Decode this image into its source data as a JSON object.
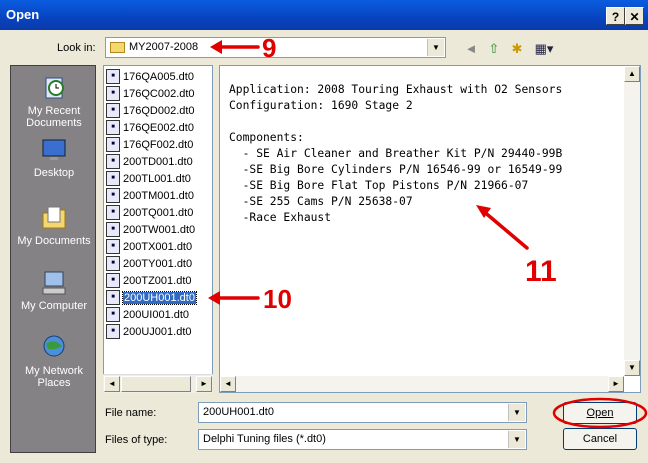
{
  "window": {
    "title": "Open",
    "help_label": "?",
    "close_label": "✕"
  },
  "look_in": {
    "label": "Look in:",
    "value": "MY2007-2008"
  },
  "places": [
    {
      "label": "My Recent Documents",
      "icon": "recent-documents-icon"
    },
    {
      "label": "Desktop",
      "icon": "desktop-icon"
    },
    {
      "label": "My Documents",
      "icon": "my-documents-icon"
    },
    {
      "label": "My Computer",
      "icon": "my-computer-icon"
    },
    {
      "label": "My Network Places",
      "icon": "network-places-icon"
    }
  ],
  "files": [
    "176QA005.dt0",
    "176QC002.dt0",
    "176QD002.dt0",
    "176QE002.dt0",
    "176QF002.dt0",
    "200TD001.dt0",
    "200TL001.dt0",
    "200TM001.dt0",
    "200TQ001.dt0",
    "200TW001.dt0",
    "200TX001.dt0",
    "200TY001.dt0",
    "200TZ001.dt0",
    "200UH001.dt0",
    "200UI001.dt0",
    "200UJ001.dt0"
  ],
  "selected_file": "200UH001.dt0",
  "preview": {
    "line1": "Application: 2008 Touring Exhaust with O2 Sensors",
    "line2": "Configuration: 1690 Stage 2",
    "line3": "",
    "line4": "Components:",
    "line5": "  - SE Air Cleaner and Breather Kit P/N 29440-99B",
    "line6": "  -SE Big Bore Cylinders P/N 16546-99 or 16549-99",
    "line7": "  -SE Big Bore Flat Top Pistons P/N 21966-07",
    "line8": "  -SE 255 Cams P/N 25638-07",
    "line9": "  -Race Exhaust"
  },
  "file_name": {
    "label": "File name:",
    "value": "200UH001.dt0"
  },
  "file_type": {
    "label": "Files of type:",
    "value": "Delphi Tuning files (*.dt0)"
  },
  "buttons": {
    "open": "Open",
    "cancel": "Cancel"
  },
  "annotations": {
    "a9": "9",
    "a10": "10",
    "a11": "11"
  },
  "colors": {
    "annotation": "#e00000",
    "title_bar": "#0843c0",
    "selection": "#316ac5"
  }
}
